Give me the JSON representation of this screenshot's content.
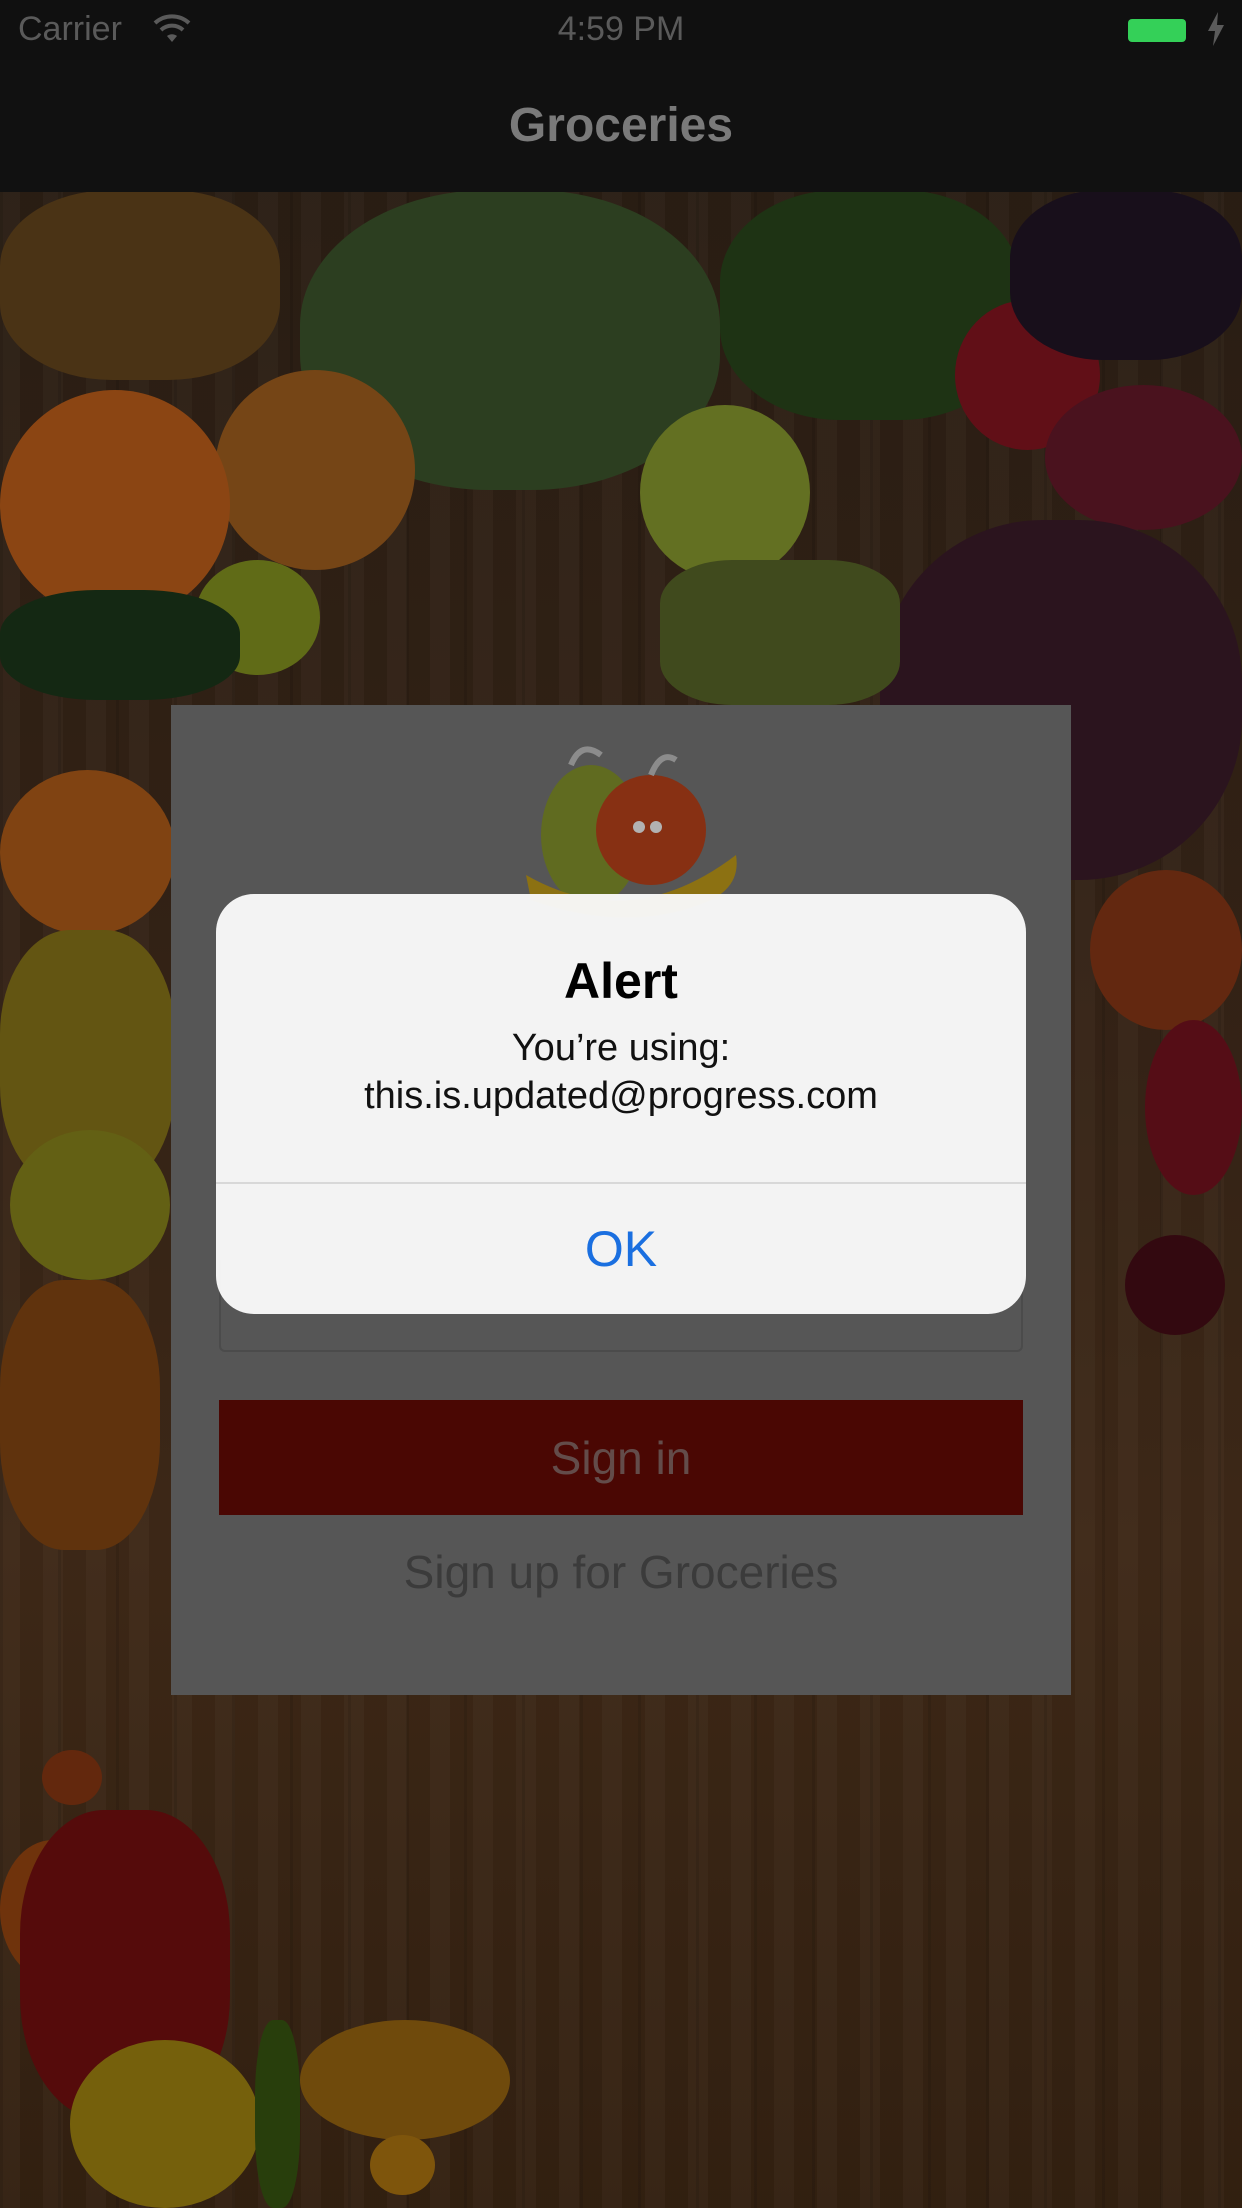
{
  "status_bar": {
    "carrier": "Carrier",
    "time": "4:59 PM",
    "battery_color": "#34d058"
  },
  "nav": {
    "title": "Groceries"
  },
  "login": {
    "signin_label": "Sign in",
    "signup_label": "Sign up for Groceries",
    "signin_color": "#6b0b05"
  },
  "alert": {
    "title": "Alert",
    "message_line1": "You’re using:",
    "message_line2": "this.is.updated@progress.com",
    "ok_label": "OK",
    "ok_color": "#1a6fe0"
  },
  "icons": {
    "wifi": "wifi-icon",
    "battery": "battery-icon",
    "charging": "charging-bolt-icon",
    "logo": "groceries-fruit-logo"
  }
}
